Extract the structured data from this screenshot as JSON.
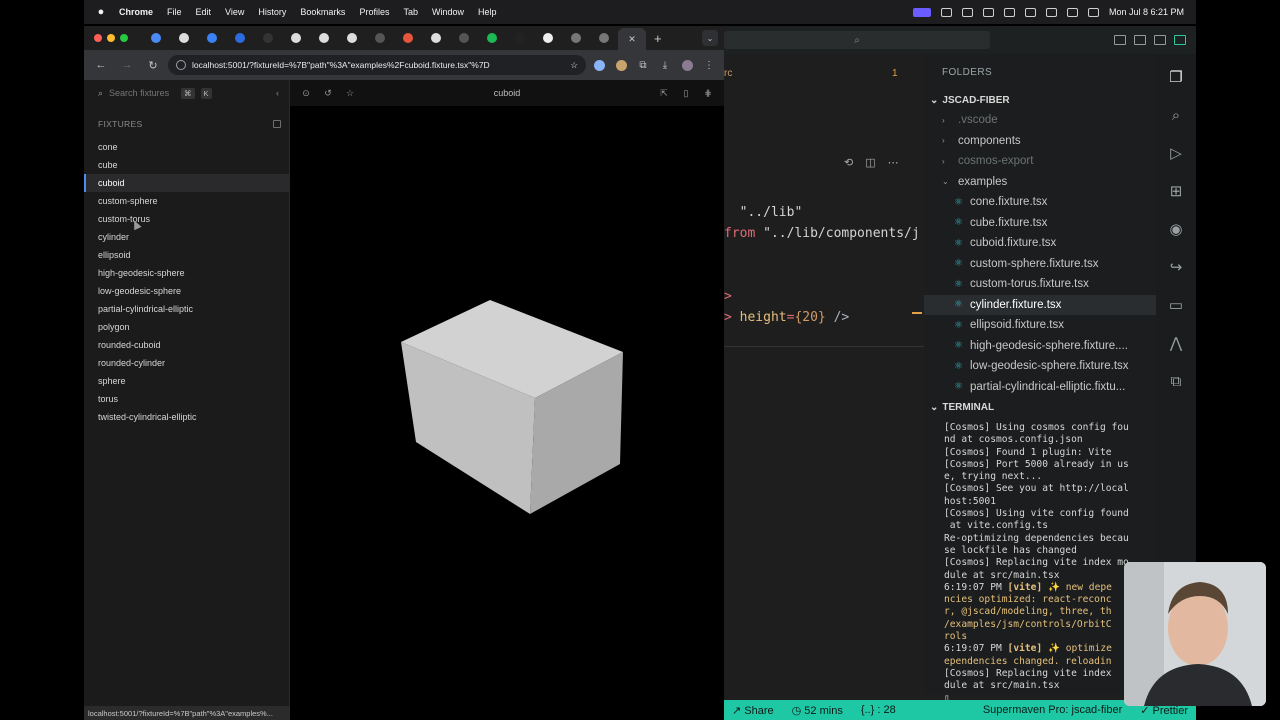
{
  "menubar": {
    "app": "Chrome",
    "items": [
      "File",
      "Edit",
      "View",
      "History",
      "Bookmarks",
      "Profiles",
      "Tab",
      "Window",
      "Help"
    ],
    "clock": "Mon Jul 8  6:21 PM"
  },
  "browser": {
    "url": "localhost:5001/?fixtureId=%7B\"path\"%3A\"examples%2Fcuboid.fixture.tsx\"%7D",
    "status_url": "localhost:5001/?fixtureId=%7B\"path\"%3A\"examples%..."
  },
  "cosmos": {
    "search_placeholder": "Search fixtures",
    "shortcut_cmd": "⌘",
    "shortcut_key": "K",
    "fixtures_heading": "FIXTURES",
    "fixtures": [
      "cone",
      "cube",
      "cuboid",
      "custom-sphere",
      "custom-torus",
      "cylinder",
      "ellipsoid",
      "high-geodesic-sphere",
      "low-geodesic-sphere",
      "partial-cylindrical-elliptic",
      "polygon",
      "rounded-cuboid",
      "rounded-cylinder",
      "sphere",
      "torus",
      "twisted-cylindrical-elliptic"
    ],
    "selected_fixture": "cuboid",
    "viewer_title": "cuboid"
  },
  "vscode": {
    "editor_tab_suffix": "rc",
    "editor_tab_count": "1",
    "code_lines": [
      {
        "parts": [
          {
            "t": "  ",
            "c": "#d4d4d4"
          },
          {
            "t": "\"../lib\"",
            "c": "#d4d4d4"
          }
        ]
      },
      {
        "parts": [
          {
            "t": "from ",
            "c": "#e06c75"
          },
          {
            "t": "\"../lib/components/j",
            "c": "#d4d4d4"
          }
        ]
      },
      {
        "parts": [
          {
            "t": "",
            "c": "#d4d4d4"
          }
        ]
      },
      {
        "parts": [
          {
            "t": "",
            "c": "#d4d4d4"
          }
        ]
      },
      {
        "parts": [
          {
            "t": ">",
            "c": "#e06c75"
          }
        ]
      },
      {
        "parts": [
          {
            "t": "> ",
            "c": "#e06c75"
          },
          {
            "t": "height",
            "c": "#e5c07b"
          },
          {
            "t": "=",
            "c": "#e06c75"
          },
          {
            "t": "{20}",
            "c": "#d19a66"
          },
          {
            "t": " />",
            "c": "#abb2bf"
          }
        ]
      }
    ],
    "explorer_heading": "FOLDERS",
    "root_folder": "JSCAD-FIBER",
    "tree": [
      {
        "label": ".vscode",
        "type": "folder",
        "dim": true,
        "indent": 1
      },
      {
        "label": "components",
        "type": "folder",
        "dim": false,
        "indent": 1
      },
      {
        "label": "cosmos-export",
        "type": "folder",
        "dim": true,
        "indent": 1
      },
      {
        "label": "examples",
        "type": "folder-open",
        "dim": false,
        "indent": 1
      },
      {
        "label": "cone.fixture.tsx",
        "type": "file",
        "dim": false,
        "indent": 2
      },
      {
        "label": "cube.fixture.tsx",
        "type": "file",
        "dim": false,
        "indent": 2
      },
      {
        "label": "cuboid.fixture.tsx",
        "type": "file",
        "dim": false,
        "indent": 2
      },
      {
        "label": "custom-sphere.fixture.tsx",
        "type": "file",
        "dim": false,
        "indent": 2
      },
      {
        "label": "custom-torus.fixture.tsx",
        "type": "file",
        "dim": false,
        "indent": 2
      },
      {
        "label": "cylinder.fixture.tsx",
        "type": "file",
        "dim": false,
        "indent": 2,
        "selected": true
      },
      {
        "label": "ellipsoid.fixture.tsx",
        "type": "file",
        "dim": false,
        "indent": 2
      },
      {
        "label": "high-geodesic-sphere.fixture....",
        "type": "file",
        "dim": false,
        "indent": 2
      },
      {
        "label": "low-geodesic-sphere.fixture.tsx",
        "type": "file",
        "dim": false,
        "indent": 2
      },
      {
        "label": "partial-cylindrical-elliptic.fixtu...",
        "type": "file",
        "dim": false,
        "indent": 2
      }
    ],
    "terminal_heading": "TERMINAL",
    "terminal_lines": [
      "[Cosmos] Using cosmos config fou",
      "nd at cosmos.config.json",
      "[Cosmos] Found 1 plugin: Vite",
      "[Cosmos] Port 5000 already in us",
      "e, trying next...",
      "[Cosmos] See you at http://local",
      "host:5001",
      "[Cosmos] Using vite config found",
      " at vite.config.ts",
      "Re-optimizing dependencies becau",
      "se lockfile has changed",
      "[Cosmos] Replacing vite index mo",
      "dule at src/main.tsx",
      "6:19:07 PM [vite] ✨ new depe",
      "ncies optimized: react-reconc",
      "r, @jscad/modeling, three, th",
      "/examples/jsm/controls/OrbitC",
      "rols",
      "6:19:07 PM [vite] ✨ optimize",
      "ependencies changed. reloadin",
      "[Cosmos] Replacing vite index",
      "dule at src/main.tsx",
      "▯"
    ],
    "status": {
      "share": "Share",
      "time": "52 mins",
      "braces": "{..} : 28",
      "supermaven": "Supermaven Pro: jscad-fiber",
      "prettier": "Prettier"
    }
  },
  "colors": {
    "accent_teal": "#1ec8a5",
    "selection_blue": "#4b8bf5",
    "cube_top": "#d2d2d2",
    "cube_left": "#c0c0c0",
    "cube_right": "#a9a9a9"
  }
}
